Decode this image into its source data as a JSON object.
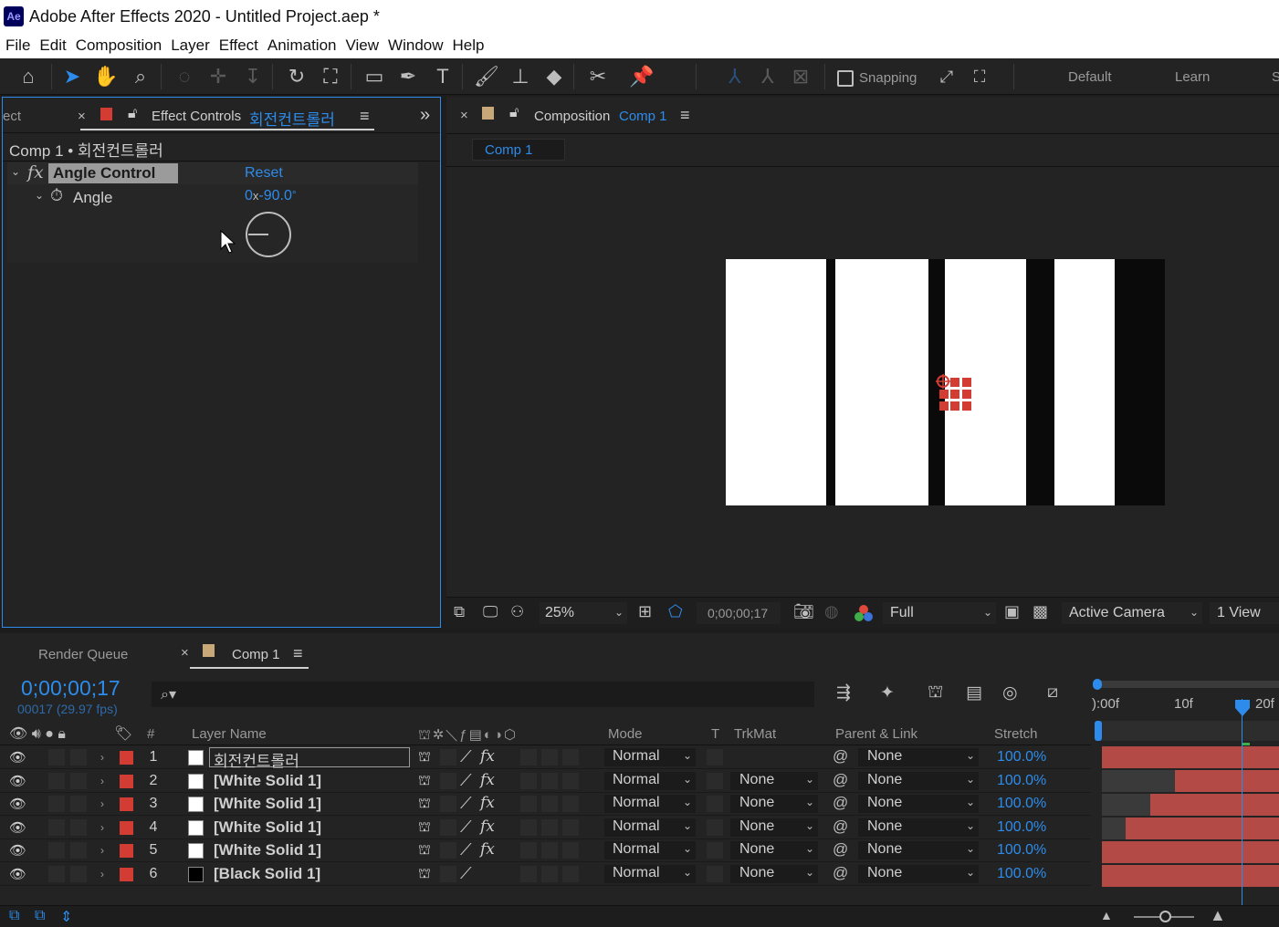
{
  "window": {
    "title": "Adobe After Effects 2020 - Untitled Project.aep *",
    "app_badge": "Ae"
  },
  "menu": [
    "File",
    "Edit",
    "Composition",
    "Layer",
    "Effect",
    "Animation",
    "View",
    "Window",
    "Help"
  ],
  "toolbar": {
    "snapping_label": "Snapping",
    "workspaces": [
      "Default",
      "Learn",
      "S"
    ]
  },
  "effect_controls": {
    "left_tab_partial": "ect",
    "tab_label": "Effect Controls",
    "tab_layer": "회전컨트롤러",
    "breadcrumb": "Comp 1 • 회전컨트롤러",
    "effect_name": "Angle Control",
    "reset_label": "Reset",
    "property_name": "Angle",
    "property_rev": "0",
    "property_x": "x",
    "property_value": "-90.0",
    "property_unit": "°"
  },
  "composition": {
    "tab_label": "Composition",
    "tab_comp": "Comp 1",
    "subtab": "Comp 1",
    "zoom": "25%",
    "timecode": "0;00;00;17",
    "resolution": "Full",
    "camera": "Active Camera",
    "views": "1 View"
  },
  "timeline": {
    "render_queue_tab": "Render Queue",
    "comp_tab": "Comp 1",
    "timecode": "0;00;00;17",
    "frame_info": "00017 (29.97 fps)",
    "ruler": [
      "):00f",
      "10f",
      "20f"
    ],
    "columns": {
      "hash": "#",
      "layer_name": "Layer Name",
      "mode": "Mode",
      "t": "T",
      "trkmat": "TrkMat",
      "parent": "Parent & Link",
      "stretch": "Stretch"
    },
    "layers": [
      {
        "index": "1",
        "name": "회전컨트롤러",
        "mode": "Normal",
        "trkmat": "",
        "parent": "None",
        "stretch": "100.0%",
        "swatch": "#ffffff",
        "fx": "fx"
      },
      {
        "index": "2",
        "name": "[White Solid 1]",
        "mode": "Normal",
        "trkmat": "None",
        "parent": "None",
        "stretch": "100.0%",
        "swatch": "#ffffff",
        "fx": "fx"
      },
      {
        "index": "3",
        "name": "[White Solid 1]",
        "mode": "Normal",
        "trkmat": "None",
        "parent": "None",
        "stretch": "100.0%",
        "swatch": "#ffffff",
        "fx": "fx"
      },
      {
        "index": "4",
        "name": "[White Solid 1]",
        "mode": "Normal",
        "trkmat": "None",
        "parent": "None",
        "stretch": "100.0%",
        "swatch": "#ffffff",
        "fx": "fx"
      },
      {
        "index": "5",
        "name": "[White Solid 1]",
        "mode": "Normal",
        "trkmat": "None",
        "parent": "None",
        "stretch": "100.0%",
        "swatch": "#ffffff",
        "fx": "fx"
      },
      {
        "index": "6",
        "name": "[Black Solid 1]",
        "mode": "Normal",
        "trkmat": "None",
        "parent": "None",
        "stretch": "100.0%",
        "swatch": "#000000",
        "fx": ""
      }
    ]
  },
  "colors": {
    "accent": "#2d8ceb",
    "label_red": "#d23c32",
    "bar_red": "#b34a45"
  }
}
